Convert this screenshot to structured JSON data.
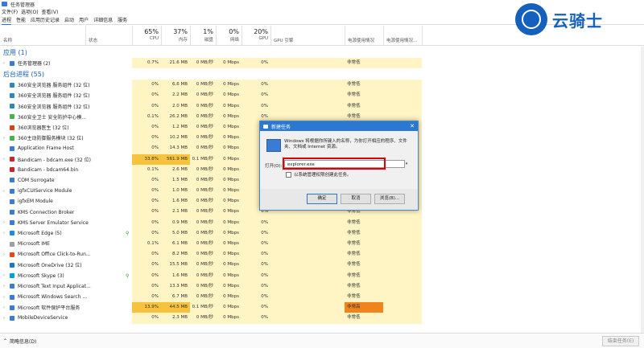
{
  "window": {
    "title": "任务管理器"
  },
  "menu": [
    "文件(F)",
    "选项(O)",
    "查看(V)"
  ],
  "tabs": [
    "进程",
    "性能",
    "应用历史记录",
    "启动",
    "用户",
    "详细信息",
    "服务"
  ],
  "header": {
    "name": "名称",
    "status": "状态",
    "cpu": {
      "pct": "65%",
      "label": "CPU"
    },
    "mem": {
      "pct": "37%",
      "label": "内存"
    },
    "disk": {
      "pct": "1%",
      "label": "磁盘"
    },
    "net": {
      "pct": "0%",
      "label": "网络"
    },
    "gpu": {
      "pct": "20%",
      "label": "GPU"
    },
    "gpu_engine": "GPU 引擎",
    "power": "电源使用情况",
    "power_trend": "电源使用情况..."
  },
  "sections": {
    "apps": "应用 (1)",
    "background": "后台进程 (55)"
  },
  "processes": [
    {
      "name": "任务管理器 (2)",
      "cpu": "0.7%",
      "mem": "21.6 MB",
      "disk": "0 MB/秒",
      "net": "0 Mbps",
      "gpu": "0%",
      "power": "非常低",
      "exp": true,
      "color": "#3a7bd5",
      "section": "apps"
    },
    {
      "name": "360安全浏览器 服务组件 (32 位)",
      "cpu": "0%",
      "mem": "6.6 MB",
      "disk": "0 MB/秒",
      "net": "0 Mbps",
      "gpu": "0%",
      "power": "非常低",
      "color": "#2e86c1"
    },
    {
      "name": "360安全浏览器 服务组件 (32 位)",
      "cpu": "0%",
      "mem": "2.2 MB",
      "disk": "0 MB/秒",
      "net": "0 Mbps",
      "gpu": "0%",
      "power": "非常低",
      "color": "#2e86c1"
    },
    {
      "name": "360安全浏览器 服务组件 (32 位)",
      "cpu": "0%",
      "mem": "2.0 MB",
      "disk": "0 MB/秒",
      "net": "0 Mbps",
      "gpu": "0%",
      "power": "非常低",
      "color": "#2e86c1"
    },
    {
      "name": "360安全卫士 安全防护中心模...",
      "cpu": "0.1%",
      "mem": "26.2 MB",
      "disk": "0 MB/秒",
      "net": "0 Mbps",
      "gpu": "0%",
      "power": "非常低",
      "color": "#4caf50"
    },
    {
      "name": "360浏览器医生 (32 位)",
      "cpu": "0%",
      "mem": "1.2 MB",
      "disk": "0 MB/秒",
      "net": "0 Mbps",
      "gpu": "0%",
      "power": "非常低",
      "color": "#d84315"
    },
    {
      "name": "360主动防御服务模块 (32 位)",
      "cpu": "0%",
      "mem": "10.2 MB",
      "disk": "0 MB/秒",
      "net": "0 Mbps",
      "gpu": "0%",
      "power": "非常低",
      "exp": true,
      "color": "#4caf50"
    },
    {
      "name": "Application Frame Host",
      "cpu": "0%",
      "mem": "14.3 MB",
      "disk": "0 MB/秒",
      "net": "0 Mbps",
      "gpu": "0%",
      "power": "非常低",
      "color": "#3a7bd5"
    },
    {
      "name": "Bandicam - bdcam.exe (32 位)",
      "cpu": "33.8%",
      "mem": "561.9 MB",
      "disk": "0.1 MB/秒",
      "net": "0 Mbps",
      "gpu": "19",
      "power": "",
      "exp": true,
      "color": "#c62828",
      "hot": true
    },
    {
      "name": "Bandicam - bdcam64.bin",
      "cpu": "0.1%",
      "mem": "2.6 MB",
      "disk": "0 MB/秒",
      "net": "0 Mbps",
      "gpu": "0%",
      "power": "",
      "color": "#c62828"
    },
    {
      "name": "COM Surrogate",
      "cpu": "0%",
      "mem": "1.5 MB",
      "disk": "0 MB/秒",
      "net": "0 Mbps",
      "gpu": "0%",
      "power": "",
      "color": "#3a7bd5"
    },
    {
      "name": "igfxCUIService Module",
      "cpu": "0%",
      "mem": "1.0 MB",
      "disk": "0 MB/秒",
      "net": "0 Mbps",
      "gpu": "0%",
      "power": "",
      "exp": true,
      "color": "#3a7bd5"
    },
    {
      "name": "igfxEM Module",
      "cpu": "0%",
      "mem": "1.6 MB",
      "disk": "0 MB/秒",
      "net": "0 Mbps",
      "gpu": "0%",
      "power": "非常低",
      "color": "#3a7bd5"
    },
    {
      "name": "KMS Connection Broker",
      "cpu": "0%",
      "mem": "2.1 MB",
      "disk": "0 MB/秒",
      "net": "0 Mbps",
      "gpu": "0%",
      "power": "非常低",
      "color": "#3a7bd5"
    },
    {
      "name": "KMS Server Emulator Service",
      "cpu": "0%",
      "mem": "0.9 MB",
      "disk": "0 MB/秒",
      "net": "0 Mbps",
      "gpu": "0%",
      "power": "非常低",
      "exp": true,
      "color": "#3a7bd5"
    },
    {
      "name": "Microsoft Edge (5)",
      "cpu": "0%",
      "mem": "5.0 MB",
      "disk": "0 MB/秒",
      "net": "0 Mbps",
      "gpu": "0%",
      "power": "非常低",
      "exp": true,
      "color": "#1e88e5",
      "leaf": true
    },
    {
      "name": "Microsoft IME",
      "cpu": "0.1%",
      "mem": "6.1 MB",
      "disk": "0 MB/秒",
      "net": "0 Mbps",
      "gpu": "0%",
      "power": "非常低",
      "color": "#9e9e9e"
    },
    {
      "name": "Microsoft Office Click-to-Run...",
      "cpu": "0%",
      "mem": "8.2 MB",
      "disk": "0 MB/秒",
      "net": "0 Mbps",
      "gpu": "0%",
      "power": "非常低",
      "exp": true,
      "color": "#e64a19"
    },
    {
      "name": "Microsoft OneDrive (32 位)",
      "cpu": "0%",
      "mem": "15.5 MB",
      "disk": "0 MB/秒",
      "net": "0 Mbps",
      "gpu": "0%",
      "power": "非常低",
      "color": "#1976d2"
    },
    {
      "name": "Microsoft Skype (3)",
      "cpu": "0%",
      "mem": "1.6 MB",
      "disk": "0 MB/秒",
      "net": "0 Mbps",
      "gpu": "0%",
      "power": "非常低",
      "exp": true,
      "color": "#039be5",
      "leaf": true
    },
    {
      "name": "Microsoft Text Input Applicat...",
      "cpu": "0%",
      "mem": "13.3 MB",
      "disk": "0 MB/秒",
      "net": "0 Mbps",
      "gpu": "0%",
      "power": "非常低",
      "exp": true,
      "color": "#3a7bd5"
    },
    {
      "name": "Microsoft Windows Search ...",
      "cpu": "0%",
      "mem": "6.7 MB",
      "disk": "0 MB/秒",
      "net": "0 Mbps",
      "gpu": "0%",
      "power": "非常低",
      "exp": true,
      "color": "#3a7bd5"
    },
    {
      "name": "Microsoft 软件保护平台服务",
      "cpu": "13.9%",
      "mem": "44.5 MB",
      "disk": "0.1 MB/秒",
      "net": "0 Mbps",
      "gpu": "0%",
      "power": "非常高",
      "exp": true,
      "color": "#3a7bd5",
      "hot": true,
      "powerhot": true
    },
    {
      "name": "MobileDeviceService",
      "cpu": "0%",
      "mem": "2.3 MB",
      "disk": "0 MB/秒",
      "net": "0 Mbps",
      "gpu": "0%",
      "power": "非常低",
      "exp": true,
      "color": "#3a7bd5"
    }
  ],
  "footer": {
    "fewer": "简略信息(D)",
    "end_task": "结束任务(E)"
  },
  "watermark": {
    "text": "云骑士"
  },
  "dialog": {
    "title": "新建任务",
    "description": "Windows 将根据你所键入的名称，为你打开相应的程序、文件夹、文档或 Internet 资源。",
    "open_label": "打开(O):",
    "open_value": "explorer.exe",
    "admin_label": "以系统管理权限创建此任务。",
    "ok": "确定",
    "cancel": "取消",
    "browse": "浏览(B)..."
  },
  "colors": {
    "accent": "#2b78d0",
    "highlight": "#e00000",
    "cell": "#fff4c4",
    "hot": "#f7c23e",
    "power_hot": "#f0831c"
  }
}
